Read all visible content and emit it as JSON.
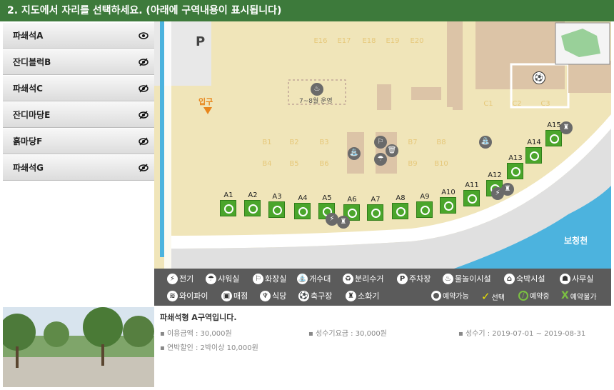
{
  "header": {
    "title": "2.  지도에서 자리를 선택하세요. (아래에 구역내용이 표시됩니다)"
  },
  "sidebar": {
    "items": [
      {
        "label": "파쇄석A"
      },
      {
        "label": "잔디블럭B"
      },
      {
        "label": "파쇄석C"
      },
      {
        "label": "잔디마당E"
      },
      {
        "label": "흙마당F"
      },
      {
        "label": "파쇄석G"
      }
    ]
  },
  "map": {
    "parking": "P",
    "entrance": "입구",
    "stream": "보청천",
    "operation_note": "7~8월 운영",
    "ghost_E": [
      "E16",
      "E17",
      "E18",
      "E19",
      "E20"
    ],
    "ghost_B_row1": [
      "B1",
      "B2",
      "B3",
      "B7",
      "B8"
    ],
    "ghost_B_row2": [
      "B4",
      "B5",
      "B6",
      "B9",
      "B10"
    ],
    "ghost_C": [
      "C1",
      "C2",
      "C3"
    ],
    "sites": [
      "A1",
      "A2",
      "A3",
      "A4",
      "A5",
      "A6",
      "A7",
      "A8",
      "A9",
      "A10",
      "A11",
      "A12",
      "A13",
      "A14",
      "A15"
    ]
  },
  "legend": {
    "row1": [
      "전기",
      "샤워실",
      "화장실",
      "개수대",
      "분리수거",
      "주차장",
      "물놀이시설",
      "숙박시설",
      "사무실"
    ],
    "row2": [
      "와이파이",
      "매점",
      "식당",
      "축구장",
      "소화기"
    ],
    "status": [
      "예약가능",
      "선택",
      "예약중",
      "예약불가"
    ]
  },
  "info": {
    "title": "파쇄석형 A구역입니다.",
    "price": "이용금액 : 30,000원",
    "peak_price": "성수기요금 : 30,000원",
    "peak_period": "성수기 : 2019-07-01 ~ 2019-08-31",
    "multi_night": "연박할인 : 2박이상 10,000원"
  },
  "colors": {
    "accent": "#3d7a3b",
    "site": "#4aa52b",
    "map": "#f0e5b9",
    "water": "#4cb3de"
  }
}
